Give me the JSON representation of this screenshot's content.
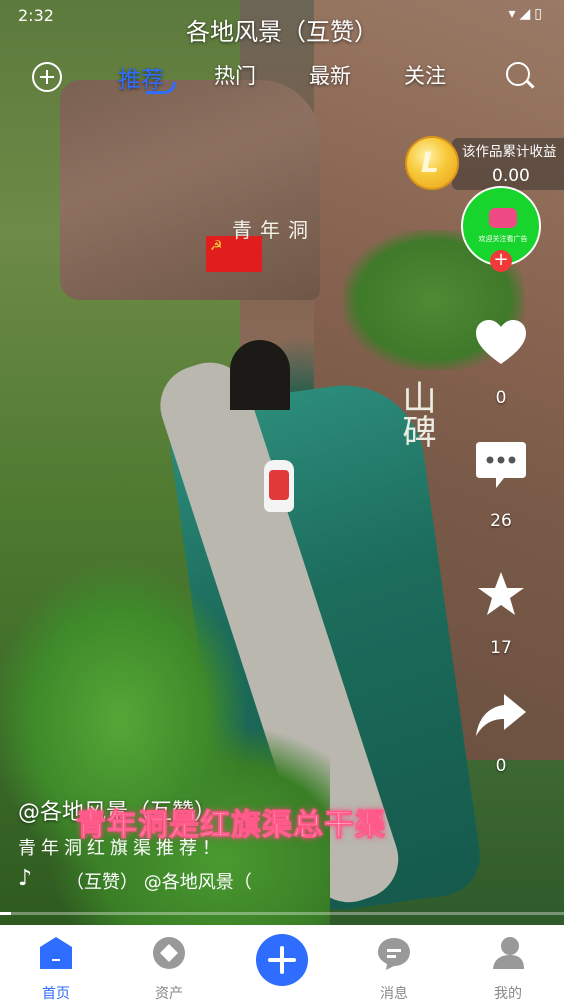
{
  "status": {
    "time": "2:32",
    "icons": "▾◢▯"
  },
  "channel_title": "各地风景（互赞）",
  "tabs": [
    {
      "label": "推荐",
      "active": true
    },
    {
      "label": "热门",
      "active": false
    },
    {
      "label": "最新",
      "active": false
    },
    {
      "label": "关注",
      "active": false
    }
  ],
  "earnings": {
    "label": "该作品累计收益",
    "value": "0.00"
  },
  "avatar": {
    "text": "欢迎关注看广告"
  },
  "rail": {
    "likes": "0",
    "comments": "26",
    "favorites": "17",
    "shares": "0"
  },
  "scene_text": {
    "cave": "青年洞",
    "mountain": "山碑"
  },
  "caption": {
    "author": "@各地风景（互赞）",
    "headline": "青年洞是红旗渠总干渠",
    "description": "青年洞红旗渠推荐！",
    "music": "（互赞）        @各地风景（"
  },
  "progress": {
    "fraction": 0.02
  },
  "bottom_nav": [
    {
      "label": "首页",
      "active": true,
      "icon": "home-icon"
    },
    {
      "label": "资产",
      "active": false,
      "icon": "asset-icon"
    },
    {
      "label": "",
      "active": false,
      "icon": "add-icon"
    },
    {
      "label": "消息",
      "active": false,
      "icon": "message-icon"
    },
    {
      "label": "我的",
      "active": false,
      "icon": "profile-icon"
    }
  ],
  "colors": {
    "accent": "#2f6dff",
    "avatar_bg": "#17d52c",
    "follow": "#f03a3a",
    "headline_glow": "#ff3f7a"
  }
}
